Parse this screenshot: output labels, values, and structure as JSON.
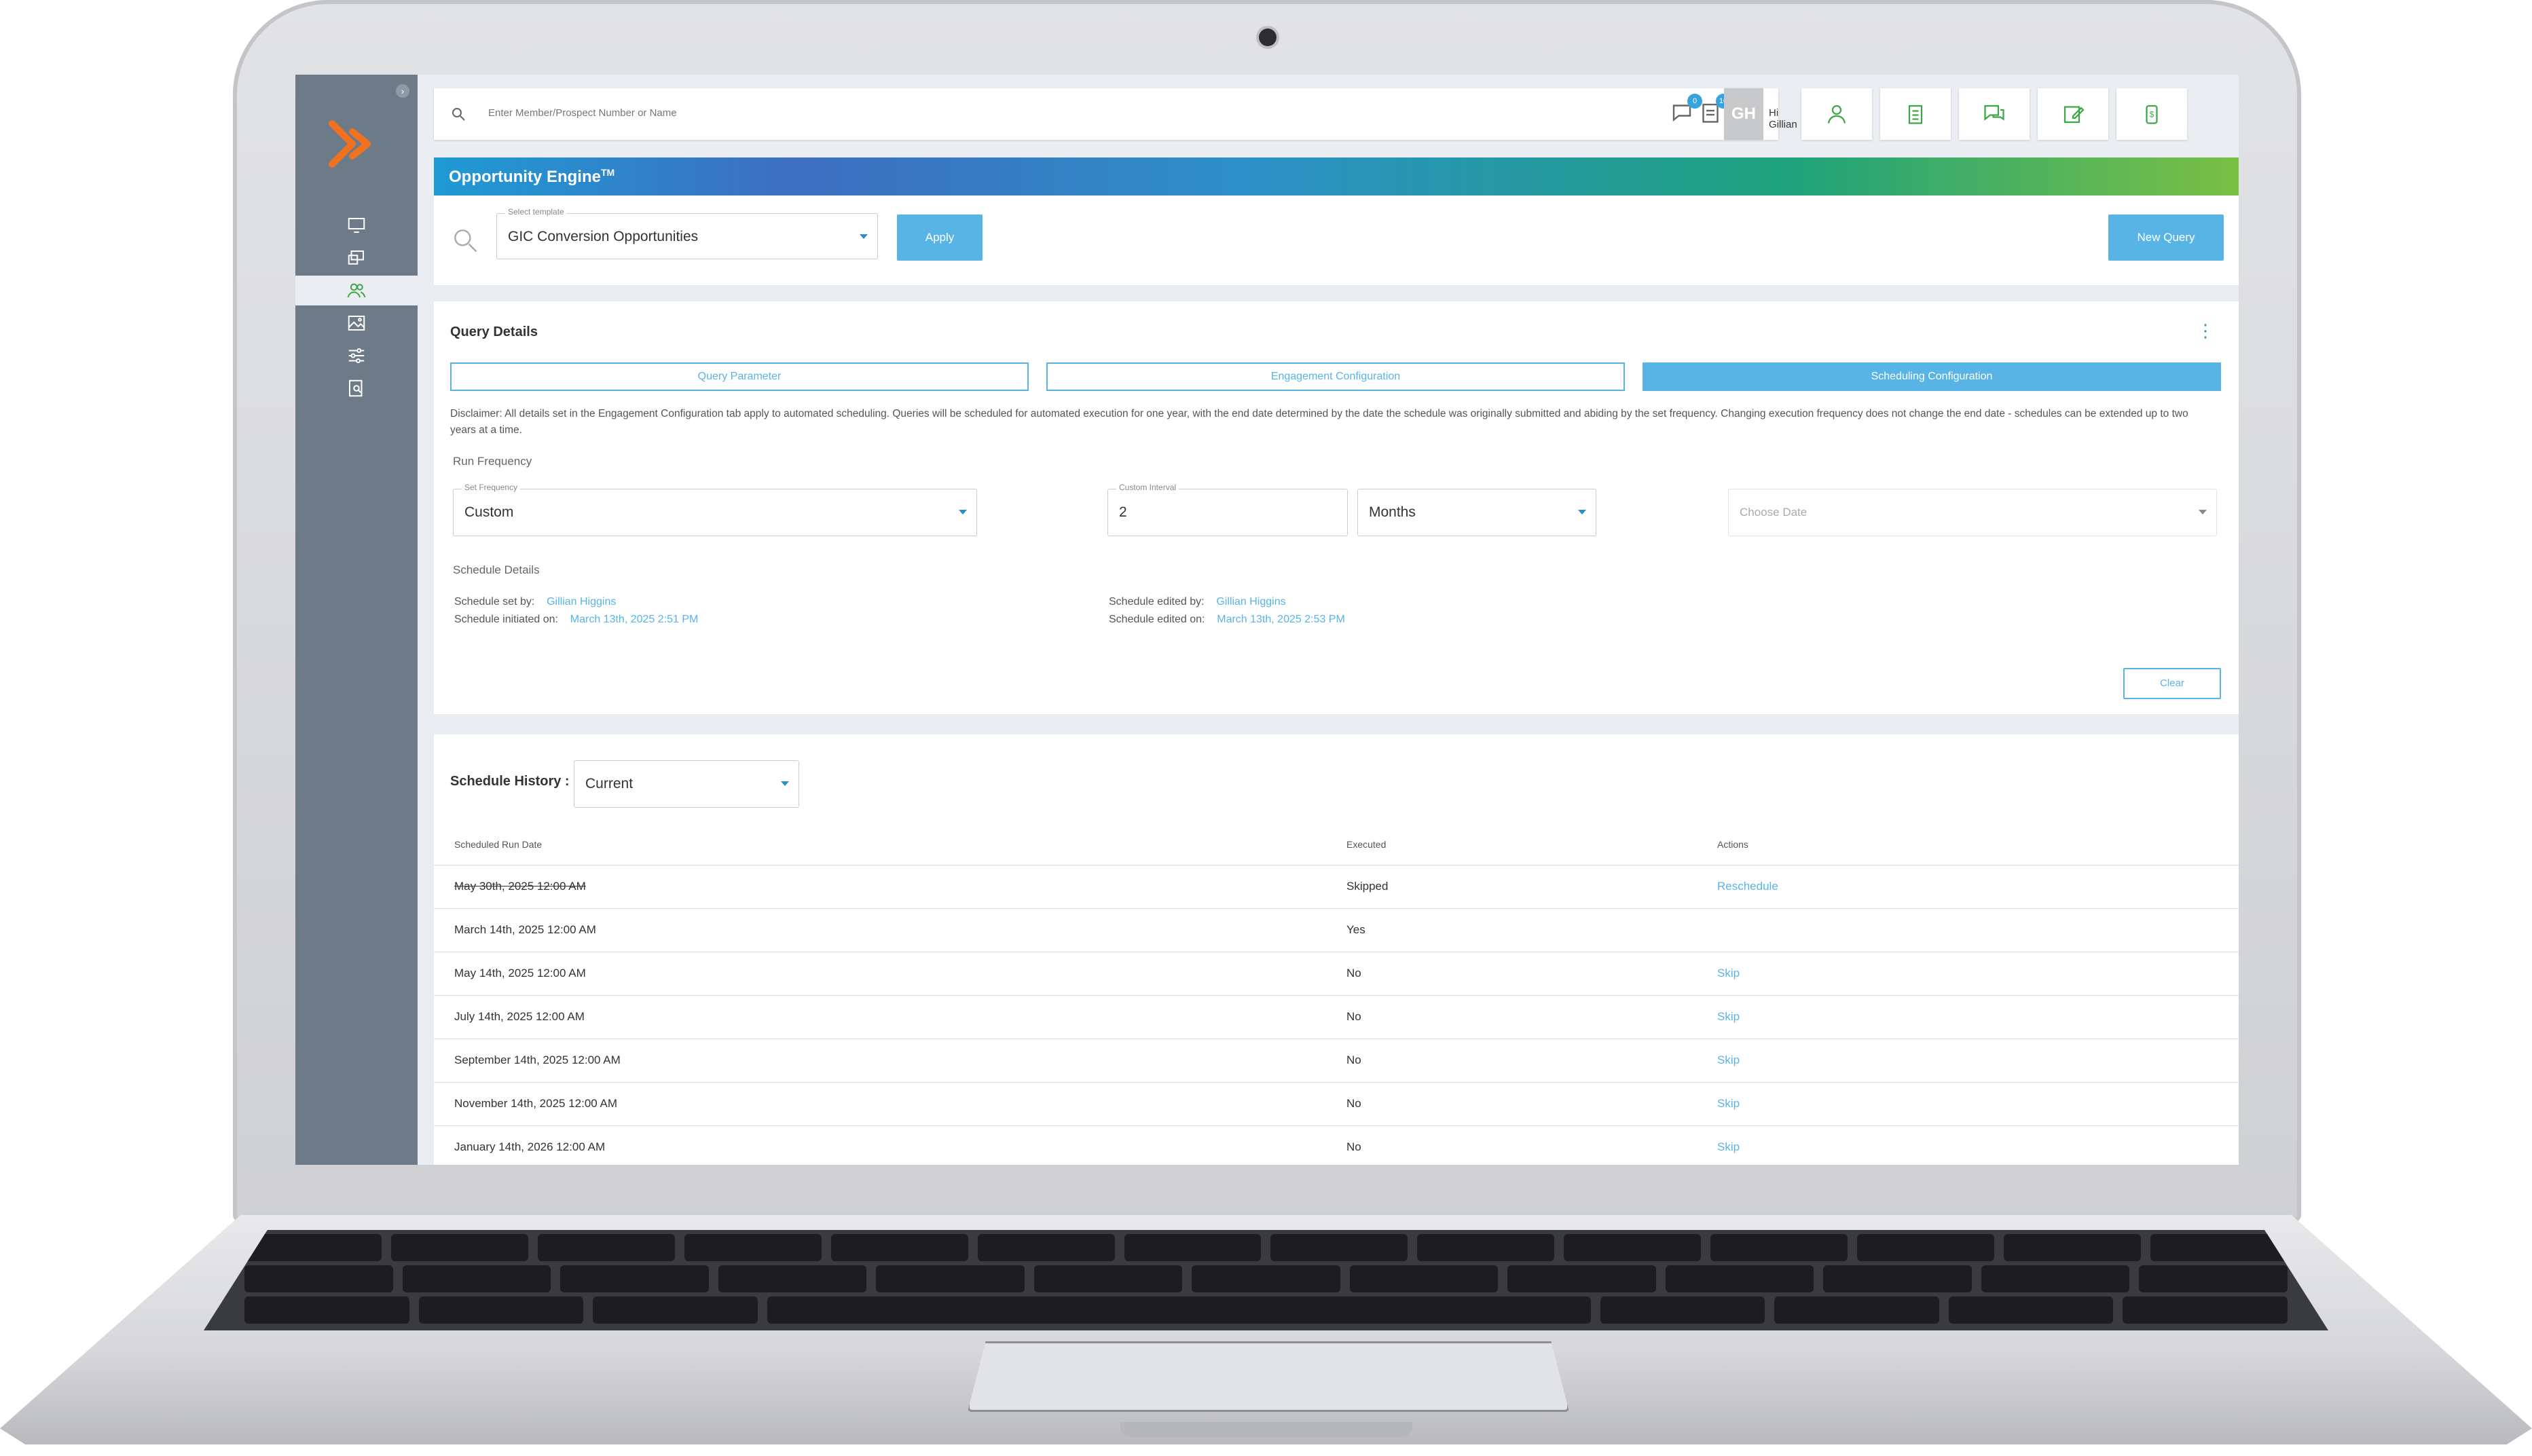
{
  "topbar": {
    "search_placeholder": "Enter Member/Prospect Number or Name",
    "messages_badge": "0",
    "tasks_badge": "10",
    "avatar_initials": "GH",
    "greeting": "Hi Gillian"
  },
  "banner": {
    "title": "Opportunity Engine",
    "superscript": "TM"
  },
  "template": {
    "label": "Select template",
    "value": "GIC Conversion Opportunities",
    "apply_label": "Apply",
    "new_query_label": "New Query"
  },
  "query_details": {
    "title": "Query Details",
    "tabs": [
      {
        "label": "Query Parameter",
        "active": false
      },
      {
        "label": "Engagement Configuration",
        "active": false
      },
      {
        "label": "Scheduling Configuration",
        "active": true
      }
    ],
    "disclaimer": "Disclaimer: All details set in the Engagement Configuration tab apply to automated scheduling. Queries will be scheduled for automated execution for one year, with the end date determined by the date the schedule was originally submitted and abiding by the set frequency. Changing execution frequency does not change the end date - schedules can be extended up to two years at a time.",
    "run_frequency_title": "Run Frequency",
    "set_frequency_label": "Set Frequency",
    "set_frequency_value": "Custom",
    "custom_interval_label": "Custom Interval",
    "custom_interval_value": "2",
    "interval_unit_value": "Months",
    "choose_date_placeholder": "Choose Date",
    "schedule_details_title": "Schedule Details",
    "set_by_label": "Schedule set by:",
    "set_by_value": "Gillian Higgins",
    "initiated_on_label": "Schedule initiated on:",
    "initiated_on_value": "March 13th, 2025 2:51 PM",
    "edited_by_label": "Schedule edited by:",
    "edited_by_value": "Gillian Higgins",
    "edited_on_label": "Schedule edited on:",
    "edited_on_value": "March 13th, 2025 2:53 PM",
    "clear_label": "Clear"
  },
  "history": {
    "label": "Schedule History :",
    "filter_value": "Current",
    "columns": [
      "Scheduled Run Date",
      "Executed",
      "Actions"
    ],
    "rows": [
      {
        "date": "May 30th, 2025 12:00 AM",
        "executed": "Skipped",
        "action": "Reschedule",
        "struck": true
      },
      {
        "date": "March 14th, 2025 12:00 AM",
        "executed": "Yes",
        "action": "",
        "struck": false
      },
      {
        "date": "May 14th, 2025 12:00 AM",
        "executed": "No",
        "action": "Skip",
        "struck": false
      },
      {
        "date": "July 14th, 2025 12:00 AM",
        "executed": "No",
        "action": "Skip",
        "struck": false
      },
      {
        "date": "September 14th, 2025 12:00 AM",
        "executed": "No",
        "action": "Skip",
        "struck": false
      },
      {
        "date": "November 14th, 2025 12:00 AM",
        "executed": "No",
        "action": "Skip",
        "struck": false
      },
      {
        "date": "January 14th, 2026 12:00 AM",
        "executed": "No",
        "action": "Skip",
        "struck": false
      }
    ]
  },
  "colors": {
    "accent_blue": "#59b4e6",
    "brand_orange": "#f0711f",
    "icon_green": "#3fa645",
    "sidebar": "#6d7b88"
  }
}
